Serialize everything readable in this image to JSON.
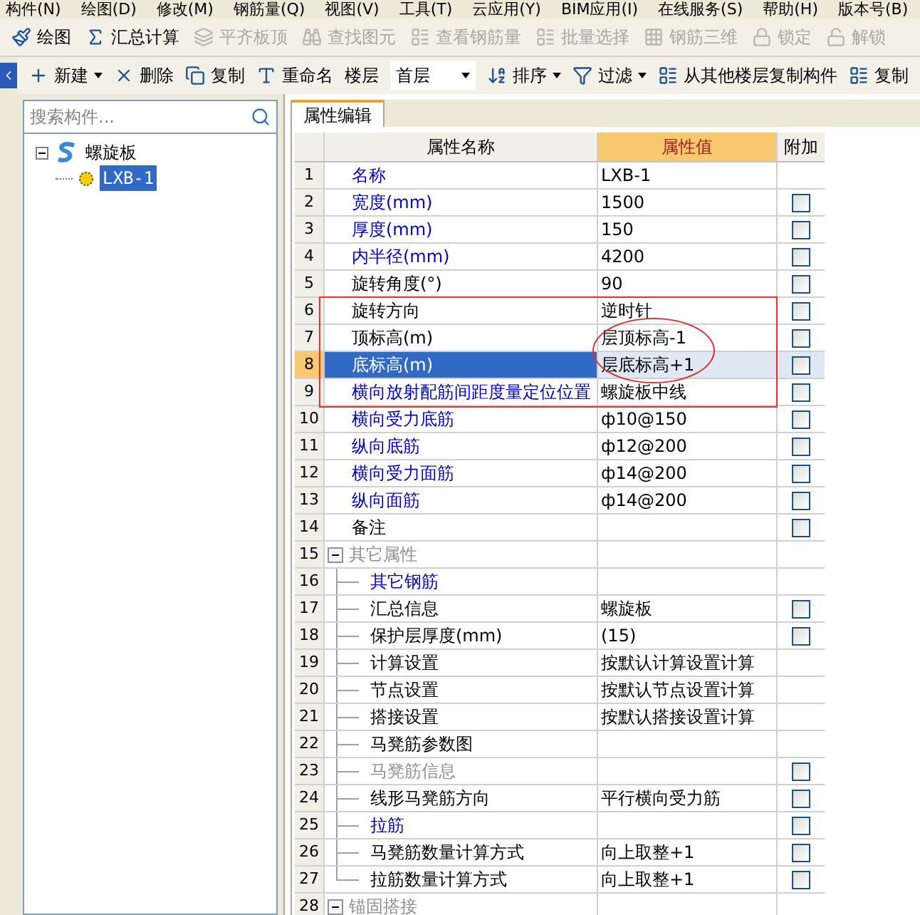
{
  "menu_bar": [
    "构件(N)",
    "绘图(D)",
    "修改(M)",
    "钢筋量(Q)",
    "视图(V)",
    "工具(T)",
    "云应用(Y)",
    "BIM应用(I)",
    "在线服务(S)",
    "帮助(H)",
    "版本号(B)"
  ],
  "toolbar": [
    {
      "label": "绘图",
      "disabled": false
    },
    {
      "label": "汇总计算",
      "disabled": false
    },
    {
      "label": "平齐板顶",
      "disabled": true
    },
    {
      "label": "查找图元",
      "disabled": true
    },
    {
      "label": "查看钢筋量",
      "disabled": true
    },
    {
      "label": "批量选择",
      "disabled": true
    },
    {
      "label": "钢筋三维",
      "disabled": true
    },
    {
      "label": "锁定",
      "disabled": true
    },
    {
      "label": "解锁",
      "disabled": true
    }
  ],
  "component_toolbar": [
    {
      "kind": "menu_button",
      "label": "新建"
    },
    {
      "kind": "button",
      "label": "删除"
    },
    {
      "kind": "button",
      "label": "复制"
    },
    {
      "kind": "button",
      "label": "重命名"
    },
    {
      "kind": "label",
      "label": "楼层"
    },
    {
      "kind": "dropdown",
      "label": "首层"
    },
    {
      "kind": "menu_button",
      "label": "排序"
    },
    {
      "kind": "menu_button",
      "label": "过滤"
    },
    {
      "kind": "button",
      "label": "从其他楼层复制构件"
    },
    {
      "kind": "button",
      "label": "复制"
    }
  ],
  "search": {
    "placeholder": "搜索构件..."
  },
  "tree": [
    {
      "label": "螺旋板",
      "expanded": true,
      "children": [
        {
          "label": "LXB-1",
          "selected": true
        }
      ]
    }
  ],
  "tabs": [
    {
      "label": "属性编辑",
      "selected": true
    }
  ],
  "table": {
    "columns": [
      "属性名称",
      "属性值",
      "附加"
    ],
    "rows": [
      {
        "num": "1",
        "name": "名称",
        "value": "LXB-1",
        "color": "#0000c8",
        "selected": false
      },
      {
        "num": "2",
        "name": "宽度(mm)",
        "value": "1500",
        "color": "#0000c8",
        "checked": false,
        "selected": false
      },
      {
        "num": "3",
        "name": "厚度(mm)",
        "value": "150",
        "color": "#0000c8",
        "checked": false,
        "selected": false
      },
      {
        "num": "4",
        "name": "内半径(mm)",
        "value": "4200",
        "color": "#0000c8",
        "checked": false,
        "selected": false
      },
      {
        "num": "5",
        "name": "旋转角度(°)",
        "value": "90",
        "color": "#000000",
        "checked": false,
        "selected": false
      },
      {
        "num": "6",
        "name": "旋转方向",
        "value": "逆时针",
        "color": "#000000",
        "checked": false,
        "selected": false
      },
      {
        "num": "7",
        "name": "顶标高(m)",
        "value": "层顶标高-1",
        "color": "#000000",
        "checked": false,
        "selected": false
      },
      {
        "num": "8",
        "name": "底标高(m)",
        "value": "层底标高+1",
        "checked": false,
        "selected": true
      },
      {
        "num": "9",
        "name": "横向放射配筋间距度量定位位置",
        "value": "螺旋板中线",
        "color": "#0000c8",
        "checked": false,
        "selected": false
      },
      {
        "num": "10",
        "name": "横向受力底筋",
        "value": "ф10@150",
        "color": "#0000c8",
        "checked": false,
        "selected": false
      },
      {
        "num": "11",
        "name": "纵向底筋",
        "value": "ф12@200",
        "color": "#0000c8",
        "checked": false,
        "selected": false
      },
      {
        "num": "12",
        "name": "横向受力面筋",
        "value": "ф14@200",
        "color": "#0000c8",
        "checked": false,
        "selected": false
      },
      {
        "num": "13",
        "name": "纵向面筋",
        "value": "ф14@200",
        "color": "#0000c8",
        "checked": false,
        "selected": false
      },
      {
        "num": "14",
        "name": "备注",
        "color": "#000000",
        "checked": false,
        "selected": false
      },
      {
        "num": "15",
        "name": "其它属性",
        "color": "#909090",
        "expanded": true,
        "selected": false,
        "children": [
          {
            "num": "16",
            "name": "其它钢筋",
            "color": "#0000c8",
            "selected": false
          },
          {
            "num": "17",
            "name": "汇总信息",
            "value": "螺旋板",
            "color": "#000000",
            "checked": false,
            "selected": false
          },
          {
            "num": "18",
            "name": "保护层厚度(mm)",
            "value": "(15)",
            "color": "#000000",
            "checked": false,
            "selected": false
          },
          {
            "num": "19",
            "name": "计算设置",
            "value": "按默认计算设置计算",
            "color": "#000000",
            "selected": false
          },
          {
            "num": "20",
            "name": "节点设置",
            "value": "按默认节点设置计算",
            "color": "#000000",
            "selected": false
          },
          {
            "num": "21",
            "name": "搭接设置",
            "value": "按默认搭接设置计算",
            "color": "#000000",
            "selected": false
          },
          {
            "num": "22",
            "name": "马凳筋参数图",
            "color": "#000000",
            "selected": false
          },
          {
            "num": "23",
            "name": "马凳筋信息",
            "color": "#909090",
            "checked": false,
            "selected": false
          },
          {
            "num": "24",
            "name": "线形马凳筋方向",
            "value": "平行横向受力筋",
            "color": "#000000",
            "checked": false,
            "selected": false
          },
          {
            "num": "25",
            "name": "拉筋",
            "color": "#0000c8",
            "checked": false,
            "selected": false
          },
          {
            "num": "26",
            "name": "马凳筋数量计算方式",
            "value": "向上取整+1",
            "color": "#000000",
            "checked": false,
            "selected": false
          },
          {
            "num": "27",
            "name": "拉筋数量计算方式",
            "value": "向上取整+1",
            "color": "#000000",
            "checked": false,
            "selected": false
          }
        ]
      },
      {
        "num": "28",
        "name": "锚固搭接",
        "color": "#909090",
        "expanded": true,
        "selected": false
      }
    ]
  }
}
